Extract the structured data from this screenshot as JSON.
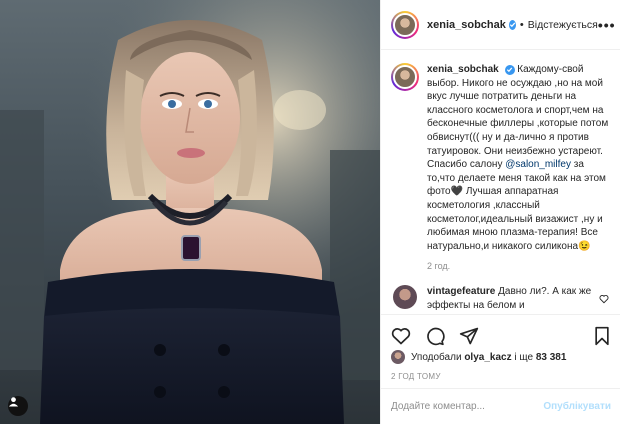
{
  "header": {
    "username": "xenia_sobchak",
    "separator": "•",
    "follow_status": "Відстежується",
    "more": "•••"
  },
  "caption": {
    "username": "xenia_sobchak",
    "text_before_mention": "Каждому-свой выбор. Никого не осуждаю ,но на мой вкус лучше потратить деньги на классного косметолога и спорт,чем на бесконечные филлеры ,которые потом обвиснут((( ну и да-лично я против татуировок. Они неизбежно устареют. Спасибо салону",
    "mention": "@salon_milfey",
    "text_after_mention": "за то,что делаете меня такой как на этом фото🖤 Лучшая аппаратная косметология ,классный косметолог,идеальный визажист ,ну и любимая мною плазма-терапия! Все натурально,и никакого силикона😉",
    "time": "2 год."
  },
  "comment": {
    "username": "vintagefeature",
    "text": "Давно ли?. А как же эффекты на белом и"
  },
  "likes": {
    "prefix": "Уподобали",
    "user": "olya_kacz",
    "joiner": "і ще",
    "count": "83 381"
  },
  "post_time": "2 ГОД ТОМУ",
  "add_comment": {
    "placeholder": "Додайте коментар...",
    "publish": "Опублікувати"
  },
  "colors": {
    "verified": "#3897f0",
    "mention": "#00376b",
    "publish_disabled": "#b2dffc",
    "muted": "#8e8e8e"
  },
  "icons": [
    "verified-icon",
    "more-icon",
    "heart-icon",
    "comment-icon",
    "share-icon",
    "bookmark-icon"
  ]
}
